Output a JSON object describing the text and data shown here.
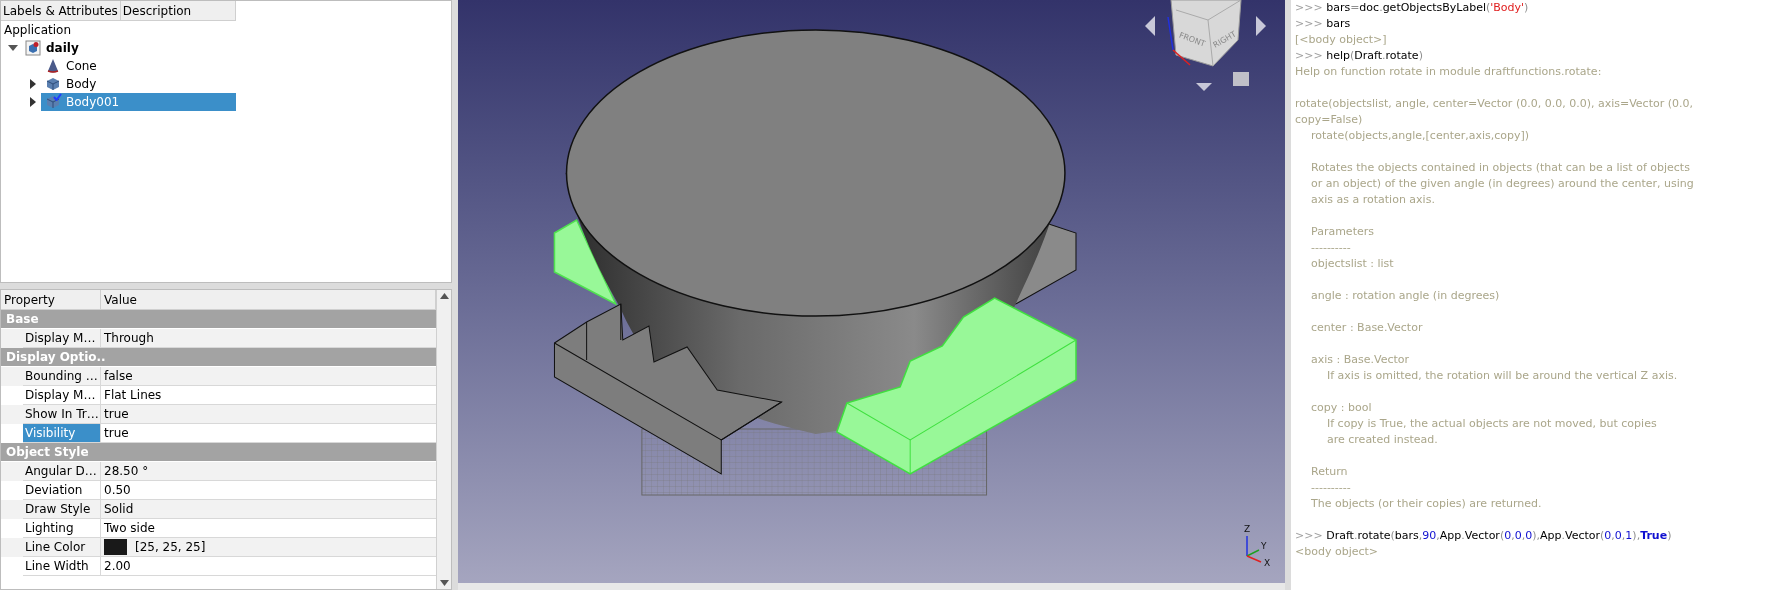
{
  "tree": {
    "columns": [
      "Labels & Attributes",
      "Description"
    ],
    "root": "Application",
    "items": [
      {
        "label": "daily",
        "kind": "document",
        "expandable": true,
        "expanded": true,
        "selected": false,
        "active": false,
        "children": [
          {
            "label": "Cone",
            "kind": "cone",
            "expandable": false,
            "expanded": false,
            "selected": false,
            "active": false
          },
          {
            "label": "Body",
            "kind": "body",
            "expandable": true,
            "expanded": false,
            "selected": false,
            "active": false
          },
          {
            "label": "Body001",
            "kind": "body",
            "expandable": true,
            "expanded": false,
            "selected": true,
            "active": true
          }
        ]
      }
    ]
  },
  "properties": {
    "columns": [
      "Property",
      "Value"
    ],
    "groups": [
      {
        "name": "Base",
        "rows": [
          {
            "name": "Display M…",
            "value": "Through",
            "kind": "text",
            "selected": false
          }
        ]
      },
      {
        "name": "Display Optio..",
        "rows": [
          {
            "name": "Bounding …",
            "value": "false",
            "kind": "text",
            "selected": false
          },
          {
            "name": "Display M…",
            "value": "Flat Lines",
            "kind": "text",
            "selected": false
          },
          {
            "name": "Show In Tr…",
            "value": "true",
            "kind": "text",
            "selected": false
          },
          {
            "name": "Visibility",
            "value": "true",
            "kind": "text",
            "selected": true
          }
        ]
      },
      {
        "name": "Object Style",
        "rows": [
          {
            "name": "Angular D…",
            "value": "28.50 °",
            "kind": "text",
            "selected": false
          },
          {
            "name": "Deviation",
            "value": "0.50",
            "kind": "text",
            "selected": false
          },
          {
            "name": "Draw Style",
            "value": "Solid",
            "kind": "text",
            "selected": false
          },
          {
            "name": "Lighting",
            "value": "Two side",
            "kind": "text",
            "selected": false
          },
          {
            "name": "Line Color",
            "value": "[25, 25, 25]",
            "kind": "color",
            "color": "#191919",
            "selected": false
          },
          {
            "name": "Line Width",
            "value": "2.00",
            "kind": "text",
            "selected": false
          }
        ]
      }
    ]
  },
  "viewport": {
    "cube_faces": [
      "FRONT",
      "RIGHT"
    ],
    "axes": [
      "Z",
      "Y",
      "X"
    ]
  },
  "console": [
    {
      "kind": "input",
      "prompt": ">>>",
      "space_before": false,
      "segments": [
        {
          "kind": "name",
          "text": "bars"
        },
        {
          "kind": "punct",
          "text": "="
        },
        {
          "kind": "name",
          "text": "doc"
        },
        {
          "kind": "punct",
          "text": "."
        },
        {
          "kind": "name",
          "text": "getObjectsByLabel"
        },
        {
          "kind": "punct",
          "text": "("
        },
        {
          "kind": "string",
          "text": "'Body'"
        },
        {
          "kind": "punct",
          "text": ")"
        }
      ]
    },
    {
      "kind": "input",
      "prompt": ">>>",
      "space_before": false,
      "segments": [
        {
          "kind": "name",
          "text": "bars"
        }
      ]
    },
    {
      "kind": "result",
      "text": "[<body object>]",
      "space_before": false
    },
    {
      "kind": "input",
      "prompt": ">>>",
      "space_before": false,
      "segments": [
        {
          "kind": "name",
          "text": "help"
        },
        {
          "kind": "punct",
          "text": "("
        },
        {
          "kind": "name",
          "text": "Draft"
        },
        {
          "kind": "punct",
          "text": "."
        },
        {
          "kind": "name",
          "text": "rotate"
        },
        {
          "kind": "punct",
          "text": ")"
        }
      ]
    },
    {
      "kind": "help",
      "text": "Help on function rotate in module draftfunctions.rotate:",
      "space_before": false
    },
    {
      "kind": "help",
      "text": "rotate(objectslist, angle, center=Vector (0.0, 0.0, 0.0), axis=Vector (0.0,",
      "space_before": true
    },
    {
      "kind": "help",
      "text": "copy=False)",
      "space_before": false
    },
    {
      "kind": "doc",
      "text": "rotate(objects,angle,[center,axis,copy])",
      "space_before": false
    },
    {
      "kind": "doc",
      "text": "Rotates the objects contained in objects (that can be a list of objects",
      "space_before": true
    },
    {
      "kind": "doc",
      "text": "or an object) of the given angle (in degrees) around the center, using",
      "space_before": false
    },
    {
      "kind": "doc",
      "text": "axis as a rotation axis.",
      "space_before": false
    },
    {
      "kind": "doc",
      "text": "Parameters",
      "space_before": true
    },
    {
      "kind": "doc",
      "text": "----------",
      "space_before": false
    },
    {
      "kind": "doc",
      "text": "objectslist : list",
      "space_before": false
    },
    {
      "kind": "doc",
      "text": "angle : rotation angle (in degrees)",
      "space_before": true
    },
    {
      "kind": "doc",
      "text": "center : Base.Vector",
      "space_before": true
    },
    {
      "kind": "doc",
      "text": "axis : Base.Vector",
      "space_before": true
    },
    {
      "kind": "detail",
      "text": "If axis is omitted, the rotation will be around the vertical Z axis.",
      "space_before": false
    },
    {
      "kind": "doc",
      "text": "copy : bool",
      "space_before": true
    },
    {
      "kind": "detail",
      "text": "If copy is True, the actual objects are not moved, but copies",
      "space_before": false
    },
    {
      "kind": "detail",
      "text": "are created instead.",
      "space_before": false
    },
    {
      "kind": "doc",
      "text": "Return",
      "space_before": true
    },
    {
      "kind": "doc",
      "text": "----------",
      "space_before": false
    },
    {
      "kind": "doc",
      "text": "The objects (or their copies) are returned.",
      "space_before": false
    },
    {
      "kind": "input",
      "prompt": ">>>",
      "space_before": true,
      "segments": [
        {
          "kind": "name",
          "text": "Draft"
        },
        {
          "kind": "punct",
          "text": "."
        },
        {
          "kind": "name",
          "text": "rotate"
        },
        {
          "kind": "punct",
          "text": "("
        },
        {
          "kind": "name",
          "text": "bars"
        },
        {
          "kind": "punct",
          "text": ","
        },
        {
          "kind": "number",
          "text": "90"
        },
        {
          "kind": "punct",
          "text": ","
        },
        {
          "kind": "name",
          "text": "App"
        },
        {
          "kind": "punct",
          "text": "."
        },
        {
          "kind": "name",
          "text": "Vector"
        },
        {
          "kind": "punct",
          "text": "("
        },
        {
          "kind": "number",
          "text": "0"
        },
        {
          "kind": "punct",
          "text": ","
        },
        {
          "kind": "number",
          "text": "0"
        },
        {
          "kind": "punct",
          "text": ","
        },
        {
          "kind": "number",
          "text": "0"
        },
        {
          "kind": "punct",
          "text": ")"
        },
        {
          "kind": "punct",
          "text": ","
        },
        {
          "kind": "name",
          "text": "App"
        },
        {
          "kind": "punct",
          "text": "."
        },
        {
          "kind": "name",
          "text": "Vector"
        },
        {
          "kind": "punct",
          "text": "("
        },
        {
          "kind": "number",
          "text": "0"
        },
        {
          "kind": "punct",
          "text": ","
        },
        {
          "kind": "number",
          "text": "0"
        },
        {
          "kind": "punct",
          "text": ","
        },
        {
          "kind": "number",
          "text": "1"
        },
        {
          "kind": "punct",
          "text": ")"
        },
        {
          "kind": "punct",
          "text": ","
        },
        {
          "kind": "keyword",
          "text": "True"
        },
        {
          "kind": "punct",
          "text": ")"
        }
      ]
    },
    {
      "kind": "result",
      "text": "<body object>",
      "space_before": false
    }
  ]
}
